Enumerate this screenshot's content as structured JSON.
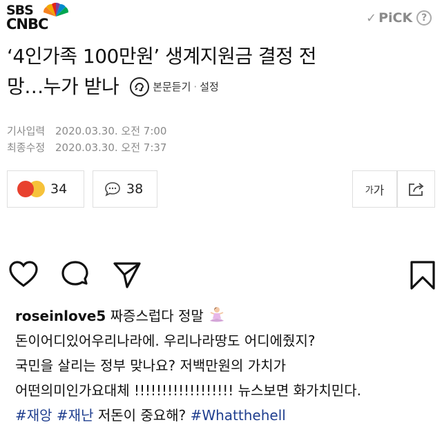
{
  "news": {
    "logo": {
      "line1": "SBS",
      "line2": "CNBC"
    },
    "pick": {
      "label": "PiCK",
      "help": "?"
    },
    "headline": {
      "line1": "‘4인가족 100만원’ 생계지원금 결정 전",
      "line2": "망…누가 받나"
    },
    "listen": {
      "label": "본문듣기",
      "separator": "·",
      "settings": "설정"
    },
    "meta": {
      "input_label": "기사입력",
      "input_time": "2020.03.30. 오전 7:00",
      "modified_label": "최종수정",
      "modified_time": "2020.03.30. 오전 7:37"
    },
    "reactions": {
      "count": "34"
    },
    "comments": {
      "count": "38"
    },
    "fontsize": {
      "small": "가",
      "large": "가"
    }
  },
  "instagram": {
    "username": "roseinlove5",
    "caption_lines": [
      "짜증스럽다 정말",
      "돈이어디있어우리나라에. 우리나라땅도 어디에줬지?",
      "국민을 살리는 정부 맞나요? 저백만원의 가치가",
      "어떤의미인가요대체 !!!!!!!!!!!!!!!!!! 뉴스보면 화가치민다."
    ],
    "hashtags": {
      "tag1": "#재앙",
      "tag2": "#재난",
      "middle_text": "저돈이 중요해?",
      "tag3": "#Whatthehell"
    }
  },
  "colors": {
    "hashtag": "#1f3e8f",
    "meta_gray": "#8a8a8a",
    "angry": "#e8412e",
    "laugh": "#f6c23a"
  },
  "icons": [
    "peacock-logo-icon",
    "check-icon",
    "help-icon",
    "speaker-icon",
    "angry-emoji-icon",
    "laugh-emoji-icon",
    "comment-icon",
    "share-icon",
    "heart-icon",
    "comment-bubble-icon",
    "send-icon",
    "bookmark-icon",
    "meditation-emoji-icon"
  ]
}
